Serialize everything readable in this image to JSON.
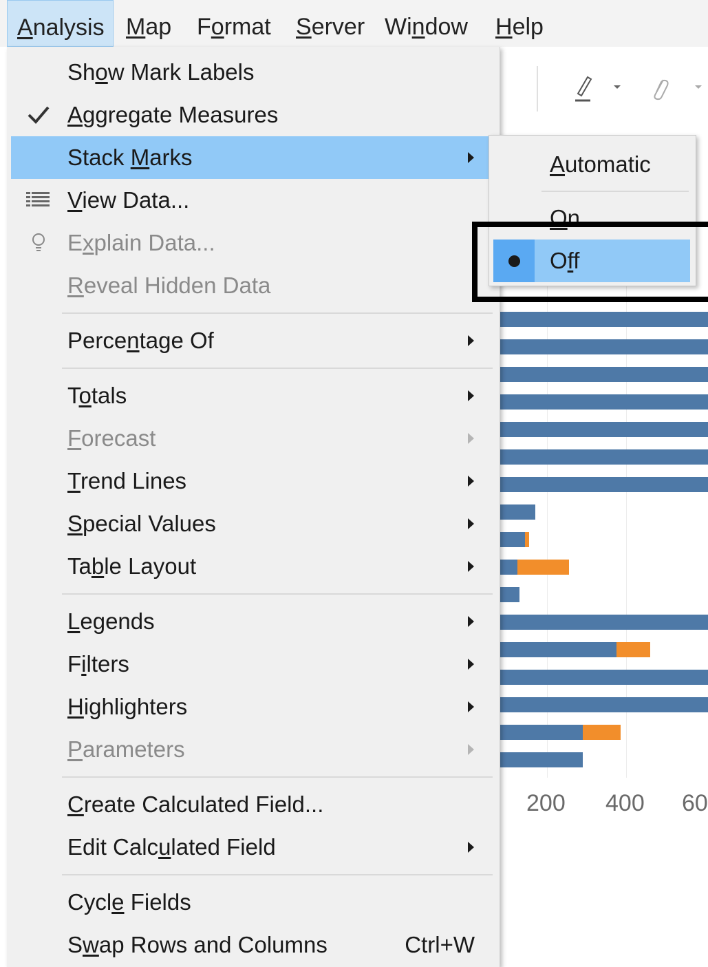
{
  "menubar": {
    "items": [
      {
        "pre": "",
        "ul": "A",
        "post": "nalysis"
      },
      {
        "pre": "",
        "ul": "M",
        "post": "ap"
      },
      {
        "pre": "F",
        "ul": "o",
        "post": "rmat"
      },
      {
        "pre": "",
        "ul": "S",
        "post": "erver"
      },
      {
        "pre": "Wi",
        "ul": "n",
        "post": "dow"
      },
      {
        "pre": "",
        "ul": "H",
        "post": "elp"
      }
    ]
  },
  "menu": {
    "items": [
      {
        "pre": "Sh",
        "ul": "o",
        "post": "w Mark Labels"
      },
      {
        "pre": "",
        "ul": "A",
        "post": "ggregate Measures"
      },
      {
        "pre": "Stack ",
        "ul": "M",
        "post": "arks"
      },
      {
        "pre": "",
        "ul": "V",
        "post": "iew Data..."
      },
      {
        "pre": "E",
        "ul": "x",
        "post": "plain Data..."
      },
      {
        "pre": "",
        "ul": "R",
        "post": "eveal Hidden Data"
      },
      {
        "pre": "Perce",
        "ul": "n",
        "post": "tage Of"
      },
      {
        "pre": "T",
        "ul": "o",
        "post": "tals"
      },
      {
        "pre": "",
        "ul": "F",
        "post": "orecast"
      },
      {
        "pre": "",
        "ul": "T",
        "post": "rend Lines"
      },
      {
        "pre": "",
        "ul": "S",
        "post": "pecial Values"
      },
      {
        "pre": "Ta",
        "ul": "b",
        "post": "le Layout"
      },
      {
        "pre": "",
        "ul": "L",
        "post": "egends"
      },
      {
        "pre": "F",
        "ul": "i",
        "post": "lters"
      },
      {
        "pre": "",
        "ul": "H",
        "post": "ighlighters"
      },
      {
        "pre": "",
        "ul": "P",
        "post": "arameters"
      },
      {
        "pre": "",
        "ul": "C",
        "post": "reate Calculated Field..."
      },
      {
        "pre": "Edit Calc",
        "ul": "u",
        "post": "lated Field"
      },
      {
        "pre": "Cycl",
        "ul": "e",
        "post": " Fields"
      },
      {
        "pre": "S",
        "ul": "w",
        "post": "ap Rows and Columns",
        "shortcut": "Ctrl+W"
      }
    ]
  },
  "submenu": {
    "items": [
      {
        "pre": "",
        "ul": "A",
        "post": "utomatic"
      },
      {
        "pre": "",
        "ul": "O",
        "post": "n"
      },
      {
        "pre": "O",
        "ul": "f",
        "post": "f"
      }
    ]
  },
  "chart": {
    "ticks": [
      "200",
      "400",
      "60"
    ]
  },
  "chart_data": {
    "type": "bar",
    "series_colors": {
      "blue": "#4e79a7",
      "orange": "#f28e2b"
    },
    "visible_bars": [
      {
        "blue": "full"
      },
      {
        "blue": "full"
      },
      {
        "blue": "full"
      },
      {
        "blue": "full"
      },
      {
        "blue": "full"
      },
      {
        "blue": "full"
      },
      {
        "blue": "full"
      },
      {
        "blue": 170
      },
      {
        "blue": 145,
        "orange": 10
      },
      {
        "blue": 125,
        "orange": 130
      },
      {
        "blue": 130
      },
      {
        "blue": "full"
      },
      {
        "blue": 375,
        "orange": 85
      },
      {
        "blue": "full"
      },
      {
        "blue": "full"
      },
      {
        "blue": 290,
        "orange": 95
      },
      {
        "blue": 290
      }
    ]
  },
  "colors": {
    "highlight": "#91c9f7",
    "radio_bg": "#5aa9f2",
    "menu_bg": "#f0f0f0"
  }
}
